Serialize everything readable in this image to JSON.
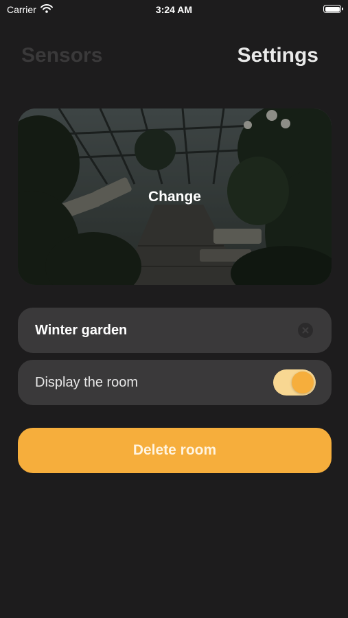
{
  "status_bar": {
    "carrier": "Carrier",
    "time": "3:24 AM"
  },
  "tabs": {
    "sensors": "Sensors",
    "settings": "Settings"
  },
  "photo": {
    "change_label": "Change",
    "subject": "greenhouse winter garden"
  },
  "room_name": {
    "value": "Winter garden"
  },
  "display_room": {
    "label": "Display the room",
    "enabled": true
  },
  "delete_button": {
    "label": "Delete room"
  },
  "colors": {
    "background": "#1d1c1d",
    "card": "#3a393a",
    "accent": "#f6ae3c"
  },
  "icons": [
    "wifi-icon",
    "battery-icon",
    "clear-icon"
  ]
}
